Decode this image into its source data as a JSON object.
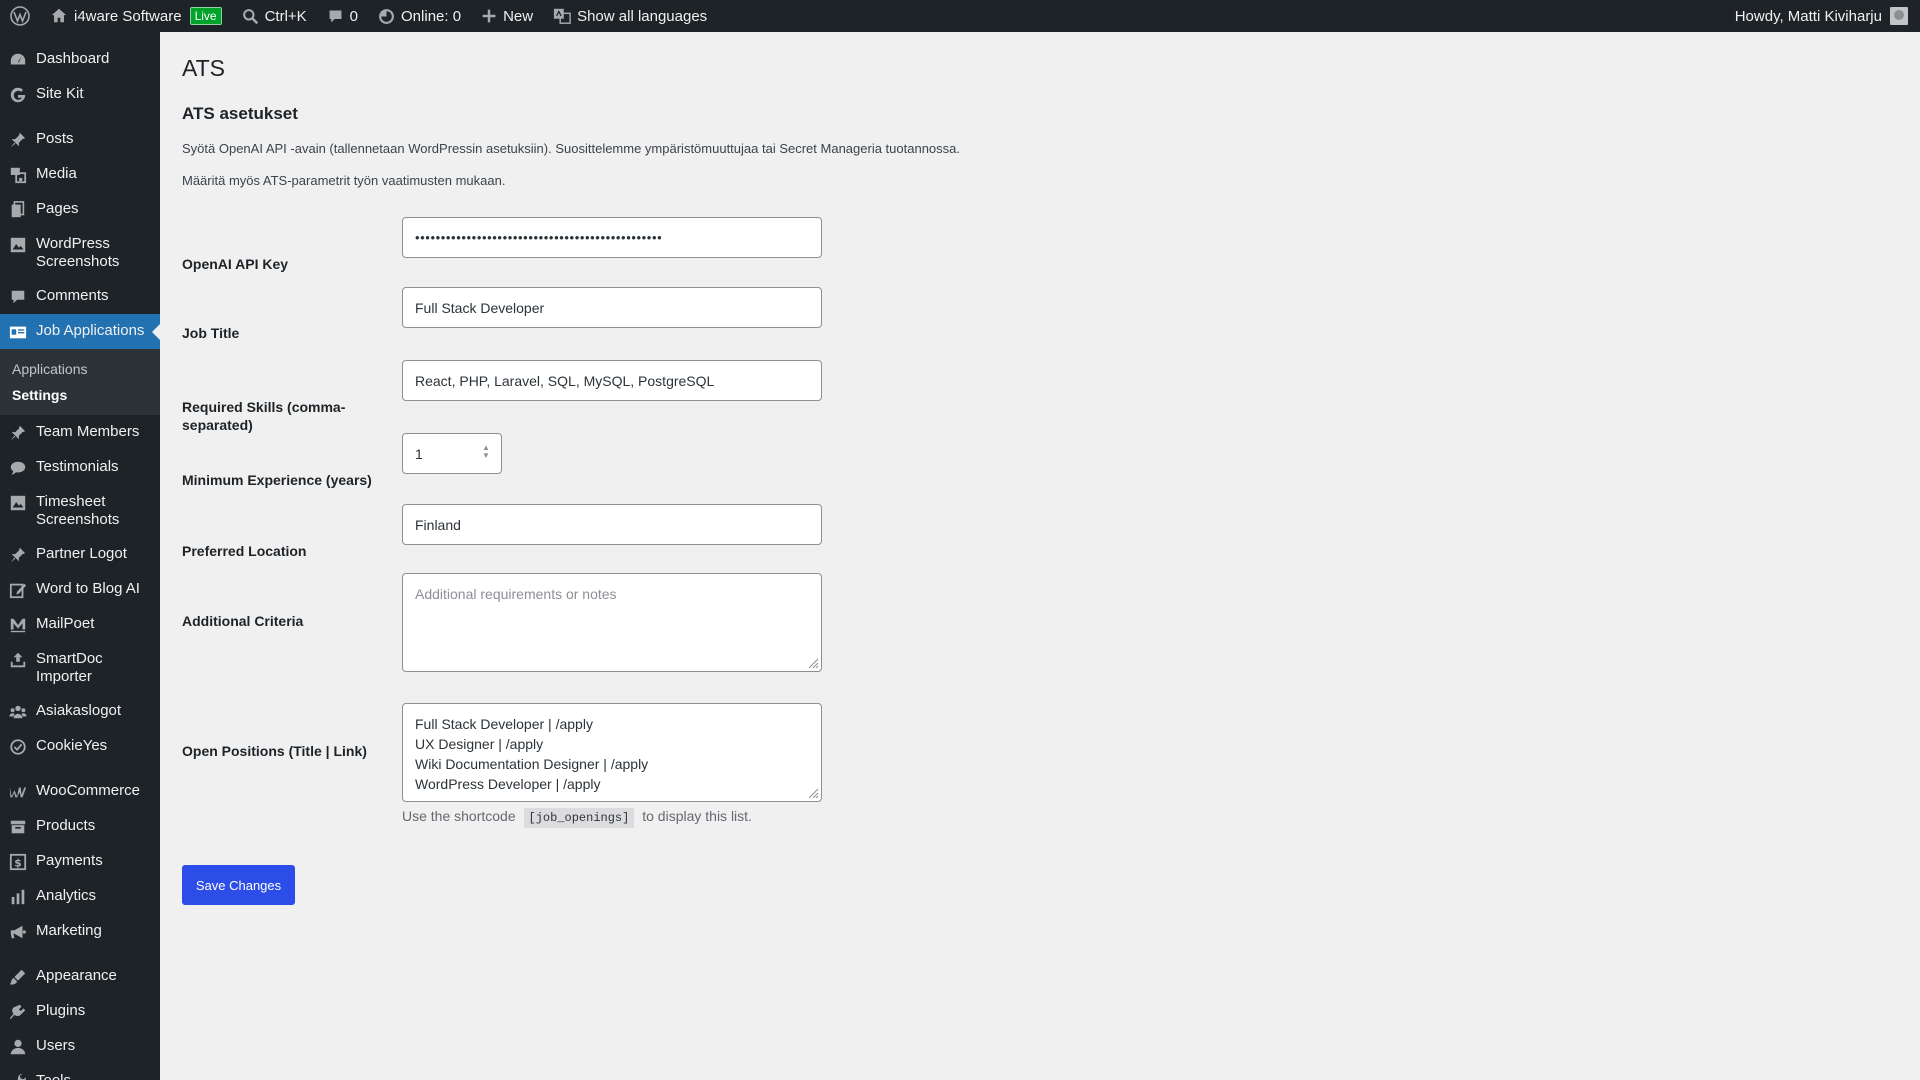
{
  "adminbar": {
    "site_name": "i4ware Software",
    "live_badge": "Live",
    "search_shortcut": "Ctrl+K",
    "comments_count": "0",
    "online": "Online: 0",
    "new_label": "New",
    "languages": "Show all languages",
    "howdy": "Howdy, Matti Kiviharju"
  },
  "sidebar": {
    "items": [
      {
        "label": "Dashboard",
        "icon": "dashboard-icon"
      },
      {
        "label": "Site Kit",
        "icon": "google-icon"
      },
      {
        "label": "Posts",
        "icon": "pin-icon"
      },
      {
        "label": "Media",
        "icon": "media-icon"
      },
      {
        "label": "Pages",
        "icon": "pages-icon"
      },
      {
        "label": "WordPress Screenshots",
        "icon": "screenshots-icon"
      },
      {
        "label": "Comments",
        "icon": "comment-icon"
      },
      {
        "label": "Job Applications",
        "icon": "id-card-icon"
      },
      {
        "label": "Team Members",
        "icon": "pin-icon"
      },
      {
        "label": "Testimonials",
        "icon": "speech-bubble-icon"
      },
      {
        "label": "Timesheet Screenshots",
        "icon": "screenshots-icon"
      },
      {
        "label": "Partner Logot",
        "icon": "pin-icon"
      },
      {
        "label": "Word to Blog AI",
        "icon": "edit-icon"
      },
      {
        "label": "MailPoet",
        "icon": "mailpoet-icon"
      },
      {
        "label": "SmartDoc Importer",
        "icon": "upload-icon"
      },
      {
        "label": "Asiakaslogot",
        "icon": "groups-icon"
      },
      {
        "label": "CookieYes",
        "icon": "cookie-icon"
      },
      {
        "label": "WooCommerce",
        "icon": "woocommerce-icon"
      },
      {
        "label": "Products",
        "icon": "archive-icon"
      },
      {
        "label": "Payments",
        "icon": "dollar-icon"
      },
      {
        "label": "Analytics",
        "icon": "bar-chart-icon"
      },
      {
        "label": "Marketing",
        "icon": "megaphone-icon"
      },
      {
        "label": "Appearance",
        "icon": "brush-icon"
      },
      {
        "label": "Plugins",
        "icon": "plugin-icon"
      },
      {
        "label": "Users",
        "icon": "user-icon"
      },
      {
        "label": "Tools",
        "icon": "wrench-icon"
      }
    ],
    "submenu": {
      "applications": "Applications",
      "settings": "Settings"
    }
  },
  "page": {
    "title": "ATS",
    "section_title": "ATS asetukset",
    "desc1": "Syötä OpenAI API -avain (tallennetaan WordPressin asetuksiin). Suosittelemme ympäristömuuttujaa tai Secret Manageria tuotannossa.",
    "desc2": "Määritä myös ATS-parametrit työn vaatimusten mukaan."
  },
  "form": {
    "api_key_label": "OpenAI API Key",
    "api_key_value": "••••••••••••••••••••••••••••••••••••••••••••••••",
    "job_title_label": "Job Title",
    "job_title_value": "Full Stack Developer",
    "skills_label": "Required Skills (comma-separated)",
    "skills_value": "React, PHP, Laravel, SQL, MySQL, PostgreSQL",
    "experience_label": "Minimum Experience (years)",
    "experience_value": "1",
    "location_label": "Preferred Location",
    "location_value": "Finland",
    "criteria_label": "Additional Criteria",
    "criteria_placeholder": "Additional requirements or notes",
    "positions_label": "Open Positions (Title | Link)",
    "positions_lines": [
      "Full Stack Developer | /apply",
      "UX Designer | /apply",
      "Wiki Documentation Designer | /apply",
      "WordPress Developer | /apply"
    ],
    "help_before": "Use the shortcode",
    "help_code": "[job_openings]",
    "help_after": "to display this list.",
    "save_label": "Save Changes"
  },
  "colors": {
    "adminbar_bg": "#1d2327",
    "active_menu": "#2271b1",
    "primary_button": "#2c4de8",
    "live_badge": "#00a32a"
  }
}
